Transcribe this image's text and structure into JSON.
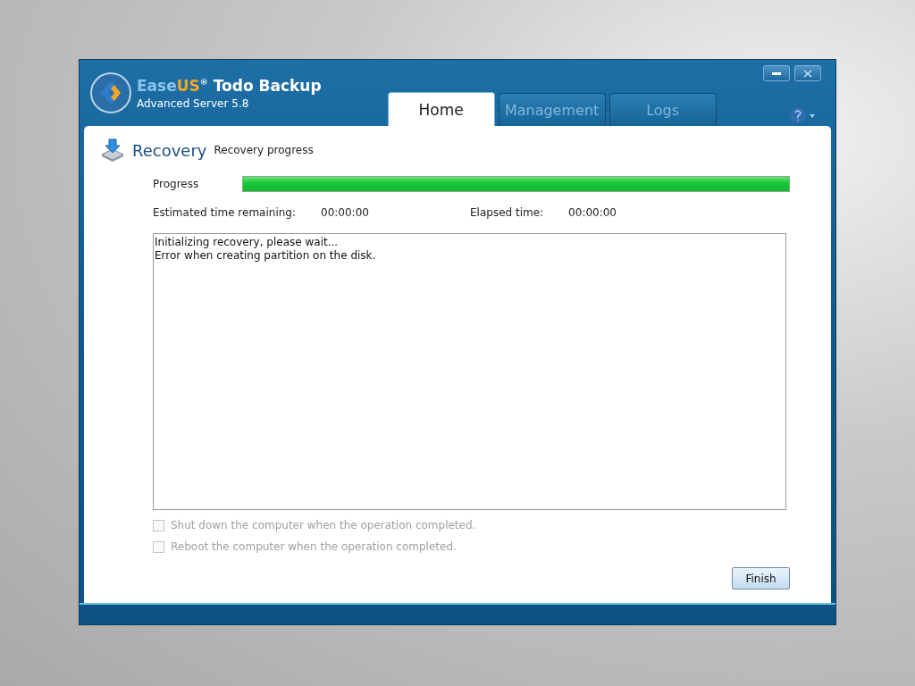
{
  "window": {
    "brand_first": "Ease",
    "brand_second": "US",
    "brand_mark": "®",
    "product": "Todo Backup",
    "edition": "Advanced Server 5.8"
  },
  "tabs": [
    {
      "label": "Home",
      "selected": true
    },
    {
      "label": "Management",
      "selected": false
    },
    {
      "label": "Logs",
      "selected": false
    }
  ],
  "header": {
    "title": "Recovery",
    "subtitle": "Recovery progress"
  },
  "progress": {
    "label": "Progress",
    "level": 1
  },
  "times": [
    {
      "label": "Estimated time remaining:",
      "value": "00:00:00"
    },
    {
      "label": "Elapsed time:",
      "value": "00:00:00"
    }
  ],
  "log": [
    "Initializing recovery, please wait...",
    "Error when creating partition on the disk."
  ],
  "options": [
    {
      "label": "Shut down the computer when the operation completed.",
      "checked": false,
      "disabled": true
    },
    {
      "label": "Reboot the computer when the operation completed.",
      "checked": false,
      "disabled": true
    }
  ],
  "buttons": [
    "Finish"
  ]
}
